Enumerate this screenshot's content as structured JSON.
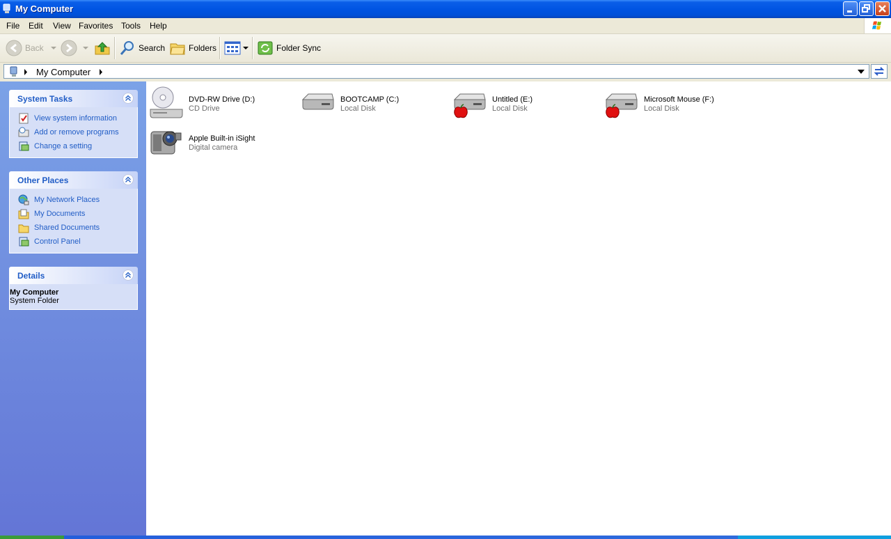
{
  "window": {
    "title": "My Computer"
  },
  "menu": [
    "File",
    "Edit",
    "View",
    "Favorites",
    "Tools",
    "Help"
  ],
  "toolbar": {
    "back": "Back",
    "search": "Search",
    "folders": "Folders",
    "folder_sync": "Folder Sync"
  },
  "address": {
    "path": "My Computer"
  },
  "sidebar": {
    "system_tasks": {
      "title": "System Tasks",
      "items": [
        "View system information",
        "Add or remove programs",
        "Change a setting"
      ]
    },
    "other_places": {
      "title": "Other Places",
      "items": [
        "My Network Places",
        "My Documents",
        "Shared Documents",
        "Control Panel"
      ]
    },
    "details": {
      "title": "Details",
      "name": "My Computer",
      "type": "System Folder"
    }
  },
  "items": [
    {
      "name": "DVD-RW Drive (D:)",
      "type": "CD Drive",
      "icon": "cd-drive-icon"
    },
    {
      "name": "BOOTCAMP (C:)",
      "type": "Local Disk",
      "icon": "hard-disk-icon"
    },
    {
      "name": "Untitled (E:)",
      "type": "Local Disk",
      "icon": "apple-disk-icon"
    },
    {
      "name": "Microsoft Mouse (F:)",
      "type": "Local Disk",
      "icon": "apple-disk-icon"
    },
    {
      "name": "Apple Built-in iSight",
      "type": "Digital camera",
      "icon": "camera-icon"
    }
  ]
}
